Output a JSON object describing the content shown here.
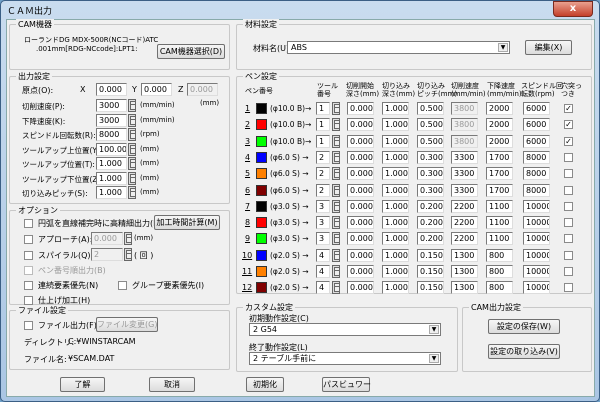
{
  "window": {
    "title": "ＣＡＭ出力",
    "close": "x"
  },
  "cam": {
    "label": "CAM機器",
    "device_line1": "ローランドDG  MDX-500R(NCコード)ATC",
    "device_line2": ".001mm[RDG-NCcode]:LPT1:",
    "select_button": "CAM機器選択(D)"
  },
  "output": {
    "label": "出力設定",
    "origin_label": "原点(O):",
    "x_label": "X",
    "x": "0.000",
    "y_label": "Y",
    "y": "0.000",
    "z_label": "Z",
    "z": "0.000",
    "z_unit": "(mm)",
    "rows": [
      {
        "label": "切削速度(P):",
        "value": "3000",
        "unit": "(mm/min)"
      },
      {
        "label": "下降速度(K):",
        "value": "3000",
        "unit": "(mm/min)"
      },
      {
        "label": "スピンドル回転数(R):",
        "value": "8000",
        "unit": "(rpm)"
      },
      {
        "label": "ツールアップ上位置(Y):",
        "value": "100.000",
        "unit": "(mm)"
      },
      {
        "label": "ツールアップ位置(T):",
        "value": "1.000",
        "unit": "(mm)"
      },
      {
        "label": "ツールアップ下位置(Z):",
        "value": "1.000",
        "unit": "(mm)"
      },
      {
        "label": "切り込みピッチ(S):",
        "value": "1.000",
        "unit": "(mm)"
      }
    ]
  },
  "options": {
    "label": "オプション",
    "arc": "円弧を直線補完時に高精細出力(E)",
    "time_button": "加工時間計算(M)",
    "approach": "アプローチ(A):",
    "approach_value": "0.000",
    "approach_unit": "(mm)",
    "spiral": "スパイラル(Q):",
    "spiral_value": "2",
    "spiral_unit": "( 回 )",
    "pen_number": "ペン番号順出力(B)",
    "continuous": "連続要素優先(N)",
    "group": "グループ要素優先(I)",
    "finish": "仕上げ加工(H)"
  },
  "file": {
    "label": "ファイル設定",
    "output": "ファイル出力(F)",
    "change_button": "ファイル変更(G)",
    "dir_label": "ディレクトリ:",
    "dir": "C:¥WINSTARCAM",
    "name_label": "ファイル名:",
    "name": "¥SCAM.DAT"
  },
  "material": {
    "label": "材料設定",
    "name_label": "材料名(U):",
    "name": "ABS",
    "edit_button": "編集(X)"
  },
  "pen": {
    "label": "ペン設定",
    "headers": [
      "ペン番号",
      "ツール\n番号",
      "切削開始\n深さ(mm)",
      "切り込み\n深さ(mm)",
      "切り込み\nピッチ(mm)",
      "切削速度\n(mm/min)",
      "下降速度\n(mm/min)",
      "スピンドル回\n転数(rpm)",
      "穴突っ\nつき"
    ],
    "rows": [
      {
        "n": "1",
        "color": "#000000",
        "tool_desc": "(φ10.0 B)→",
        "tool": "1",
        "start": "0.000",
        "depth": "1.000",
        "pitch": "0.500",
        "speed": "3800",
        "down": "2000",
        "spindle": "6000",
        "hole": true,
        "speed_disabled": true
      },
      {
        "n": "2",
        "color": "#ff0000",
        "tool_desc": "(φ10.0 B)→",
        "tool": "1",
        "start": "0.000",
        "depth": "1.000",
        "pitch": "0.500",
        "speed": "3800",
        "down": "2000",
        "spindle": "6000",
        "hole": true,
        "speed_disabled": true
      },
      {
        "n": "3",
        "color": "#00ff00",
        "tool_desc": "(φ10.0 B)→",
        "tool": "1",
        "start": "0.000",
        "depth": "1.000",
        "pitch": "0.500",
        "speed": "3800",
        "down": "2000",
        "spindle": "6000",
        "hole": true,
        "speed_disabled": true
      },
      {
        "n": "4",
        "color": "#0000ff",
        "tool_desc": "(φ6.0 S) →",
        "tool": "2",
        "start": "0.000",
        "depth": "1.000",
        "pitch": "0.300",
        "speed": "3300",
        "down": "1700",
        "spindle": "8000",
        "hole": false
      },
      {
        "n": "5",
        "color": "#ff8000",
        "tool_desc": "(φ6.0 S) →",
        "tool": "2",
        "start": "0.000",
        "depth": "1.000",
        "pitch": "0.300",
        "speed": "3300",
        "down": "1700",
        "spindle": "8000",
        "hole": false
      },
      {
        "n": "6",
        "color": "#800000",
        "tool_desc": "(φ6.0 S) →",
        "tool": "2",
        "start": "0.000",
        "depth": "1.000",
        "pitch": "0.300",
        "speed": "3300",
        "down": "1700",
        "spindle": "8000",
        "hole": false
      },
      {
        "n": "7",
        "color": "#000000",
        "tool_desc": "(φ3.0 S) →",
        "tool": "3",
        "start": "0.000",
        "depth": "1.000",
        "pitch": "0.200",
        "speed": "2200",
        "down": "1100",
        "spindle": "10000",
        "hole": false
      },
      {
        "n": "8",
        "color": "#ff0000",
        "tool_desc": "(φ3.0 S) →",
        "tool": "3",
        "start": "0.000",
        "depth": "1.000",
        "pitch": "0.200",
        "speed": "2200",
        "down": "1100",
        "spindle": "10000",
        "hole": false
      },
      {
        "n": "9",
        "color": "#00ff00",
        "tool_desc": "(φ3.0 S) →",
        "tool": "3",
        "start": "0.000",
        "depth": "1.000",
        "pitch": "0.200",
        "speed": "2200",
        "down": "1100",
        "spindle": "10000",
        "hole": false
      },
      {
        "n": "10",
        "color": "#0000ff",
        "tool_desc": "(φ2.0 S) →",
        "tool": "4",
        "start": "0.000",
        "depth": "1.000",
        "pitch": "0.150",
        "speed": "1300",
        "down": "800",
        "spindle": "10000",
        "hole": false
      },
      {
        "n": "11",
        "color": "#ff8000",
        "tool_desc": "(φ2.0 S) →",
        "tool": "4",
        "start": "0.000",
        "depth": "1.000",
        "pitch": "0.150",
        "speed": "1300",
        "down": "800",
        "spindle": "10000",
        "hole": false
      },
      {
        "n": "12",
        "color": "#800000",
        "tool_desc": "(φ2.0 S) →",
        "tool": "4",
        "start": "0.000",
        "depth": "1.000",
        "pitch": "0.150",
        "speed": "1300",
        "down": "800",
        "spindle": "10000",
        "hole": false
      }
    ]
  },
  "custom": {
    "label": "カスタム設定",
    "init_label": "初期動作設定(C)",
    "init_value": "2 G54",
    "end_label": "終了動作設定(L)",
    "end_value": "2 テーブル手前に"
  },
  "camout": {
    "label": "CAM出力設定",
    "save_button": "設定の保存(W)",
    "load_button": "設定の取り込み(V)"
  },
  "buttons": {
    "ok": "了解",
    "cancel": "取消",
    "init": "初期化",
    "path_viewer": "パスビュワー"
  }
}
